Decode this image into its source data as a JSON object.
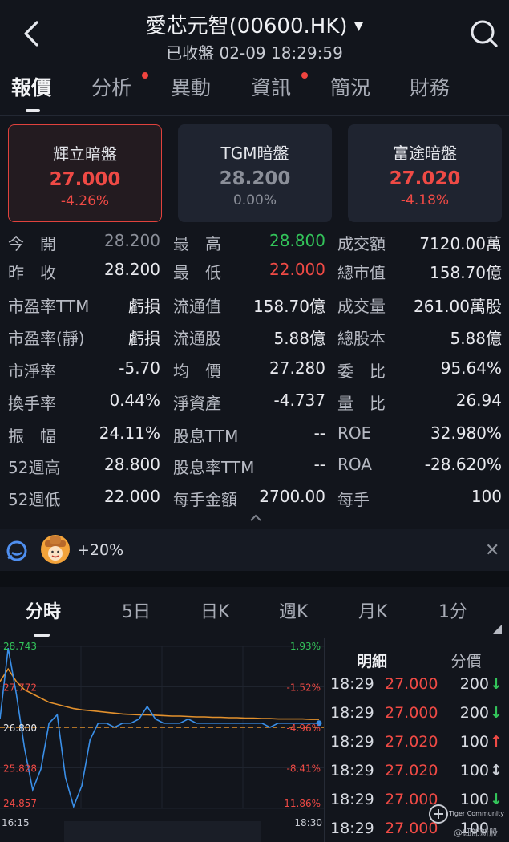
{
  "header": {
    "back_icon": "chevron-left-icon",
    "title": "愛芯元智(00600.HK)",
    "subtitle": "已收盤  02-09  18:29:59",
    "search_icon": "search-icon"
  },
  "tabs": [
    {
      "label": "報價",
      "active": true,
      "dot": false
    },
    {
      "label": "分析",
      "active": false,
      "dot": true
    },
    {
      "label": "異動",
      "active": false,
      "dot": false
    },
    {
      "label": "資訊",
      "active": false,
      "dot": true
    },
    {
      "label": "簡況",
      "active": false,
      "dot": false
    },
    {
      "label": "財務",
      "active": false,
      "dot": false
    }
  ],
  "dark_pools": [
    {
      "name": "輝立暗盤",
      "price": "27.000",
      "change": "-4.26%",
      "selected": true,
      "color": "#ef4a45"
    },
    {
      "name": "TGM暗盤",
      "price": "28.200",
      "change": "0.00%",
      "selected": false,
      "color": "#8b8f99"
    },
    {
      "name": "富途暗盤",
      "price": "27.020",
      "change": "-4.18%",
      "selected": false,
      "color": "#ef4a45"
    }
  ],
  "stats": {
    "col1": [
      {
        "label": "今　開",
        "value": "28.200",
        "color": "#8b8f99"
      },
      {
        "label": "昨　收",
        "value": "28.200",
        "color": "#e8e9ee"
      },
      {
        "label": "市盈率TTM",
        "value": "虧損",
        "color": "#e8e9ee"
      },
      {
        "label": "市盈率(靜)",
        "value": "虧損",
        "color": "#e8e9ee"
      },
      {
        "label": "市淨率",
        "value": "-5.70",
        "color": "#e8e9ee"
      },
      {
        "label": "換手率",
        "value": "0.44%",
        "color": "#e8e9ee"
      },
      {
        "label": "振　幅",
        "value": "24.11%",
        "color": "#e8e9ee"
      },
      {
        "label": "52週高",
        "value": "28.800",
        "color": "#e8e9ee"
      },
      {
        "label": "52週低",
        "value": "22.000",
        "color": "#e8e9ee"
      }
    ],
    "col2": [
      {
        "label": "最　高",
        "value": "28.800",
        "color": "#33c45a"
      },
      {
        "label": "最　低",
        "value": "22.000",
        "color": "#ef4a45"
      },
      {
        "label": "流通值",
        "value": "158.70億",
        "color": "#e8e9ee"
      },
      {
        "label": "流通股",
        "value": "5.88億",
        "color": "#e8e9ee"
      },
      {
        "label": "均　價",
        "value": "27.280",
        "color": "#e8e9ee"
      },
      {
        "label": "淨資產",
        "value": "-4.737",
        "color": "#e8e9ee"
      },
      {
        "label": "股息TTM",
        "value": "--",
        "color": "#e8e9ee"
      },
      {
        "label": "股息率TTM",
        "value": "--",
        "color": "#e8e9ee"
      },
      {
        "label": "每手金額",
        "value": "2700.00",
        "color": "#e8e9ee"
      }
    ],
    "col3": [
      {
        "label": "成交額",
        "value": "7120.00萬",
        "color": "#e8e9ee"
      },
      {
        "label": "總市值",
        "value": "158.70億",
        "color": "#e8e9ee"
      },
      {
        "label": "成交量",
        "value": "261.00萬股",
        "color": "#e8e9ee"
      },
      {
        "label": "總股本",
        "value": "5.88億",
        "color": "#e8e9ee"
      },
      {
        "label": "委　比",
        "value": "95.64%",
        "color": "#e8e9ee"
      },
      {
        "label": "量　比",
        "value": "26.94",
        "color": "#e8e9ee"
      },
      {
        "label": "ROE",
        "value": "32.980%",
        "color": "#e8e9ee"
      },
      {
        "label": "ROA",
        "value": "-28.620%",
        "color": "#e8e9ee"
      },
      {
        "label": "每手",
        "value": "100",
        "color": "#e8e9ee"
      }
    ]
  },
  "promo": {
    "text": "+20%",
    "bot_icon": "chat-bot-icon",
    "avatar_icon": "cowboy-avatar-icon",
    "close_icon": "close-icon"
  },
  "chart_tabs": [
    {
      "label": "分時",
      "active": true
    },
    {
      "label": "5日",
      "active": false
    },
    {
      "label": "日K",
      "active": false
    },
    {
      "label": "週K",
      "active": false
    },
    {
      "label": "月K",
      "active": false
    },
    {
      "label": "1分",
      "active": false
    }
  ],
  "chart_data": {
    "type": "line",
    "x_start": "16:15",
    "x_end": "18:30",
    "ylim": [
      24.857,
      28.743
    ],
    "y_ticks": [
      "28.743",
      "27.772",
      "26.800",
      "25.828",
      "24.857"
    ],
    "pct_ticks": [
      "1.93%",
      "-1.52%",
      "-4.96%",
      "-8.41%",
      "-11.86%"
    ],
    "reference_price": 26.8,
    "series": [
      {
        "color": "#3a8fe8",
        "values": [
          27.0,
          28.7,
          27.6,
          26.3,
          25.3,
          25.8,
          26.9,
          27.1,
          25.6,
          24.9,
          25.4,
          26.5,
          26.9,
          26.9,
          26.8,
          26.9,
          26.9,
          27.0,
          27.3,
          27.0,
          26.9,
          26.9,
          26.9,
          27.0,
          26.9,
          26.9,
          26.9,
          26.9,
          26.9,
          26.9,
          26.9,
          26.9,
          26.9,
          26.8,
          26.9,
          26.9,
          26.9,
          26.9,
          26.9,
          26.9
        ]
      },
      {
        "color": "#e3912d",
        "values": [
          27.9,
          28.2,
          27.9,
          27.7,
          27.6,
          27.5,
          27.4,
          27.35,
          27.3,
          27.25,
          27.22,
          27.2,
          27.18,
          27.16,
          27.14,
          27.12,
          27.11,
          27.1,
          27.1,
          27.09,
          27.08,
          27.07,
          27.07,
          27.06,
          27.05,
          27.05,
          27.04,
          27.04,
          27.03,
          27.03,
          27.02,
          27.02,
          27.01,
          27.01,
          27.0,
          27.0,
          27.0,
          27.0,
          26.99,
          26.99
        ]
      }
    ]
  },
  "detail": {
    "headers": [
      "明細",
      "分價"
    ],
    "rows": [
      {
        "time": "18:29",
        "price": "27.000",
        "qty": "200",
        "arrow": "↓",
        "arrow_color": "#33c45a"
      },
      {
        "time": "18:29",
        "price": "27.000",
        "qty": "200",
        "arrow": "↓",
        "arrow_color": "#33c45a"
      },
      {
        "time": "18:29",
        "price": "27.020",
        "qty": "100",
        "arrow": "↑",
        "arrow_color": "#ef4a45"
      },
      {
        "time": "18:29",
        "price": "27.020",
        "qty": "100",
        "arrow": "↕",
        "arrow_color": "#c9ccd4"
      },
      {
        "time": "18:29",
        "price": "27.000",
        "qty": "100",
        "arrow": "↓",
        "arrow_color": "#33c45a"
      },
      {
        "time": "18:29",
        "price": "27.000",
        "qty": "100",
        "arrow": "",
        "arrow_color": "#c9ccd4"
      }
    ],
    "watermark": "@細節新股"
  },
  "watermark_brand": "Tiger Community"
}
